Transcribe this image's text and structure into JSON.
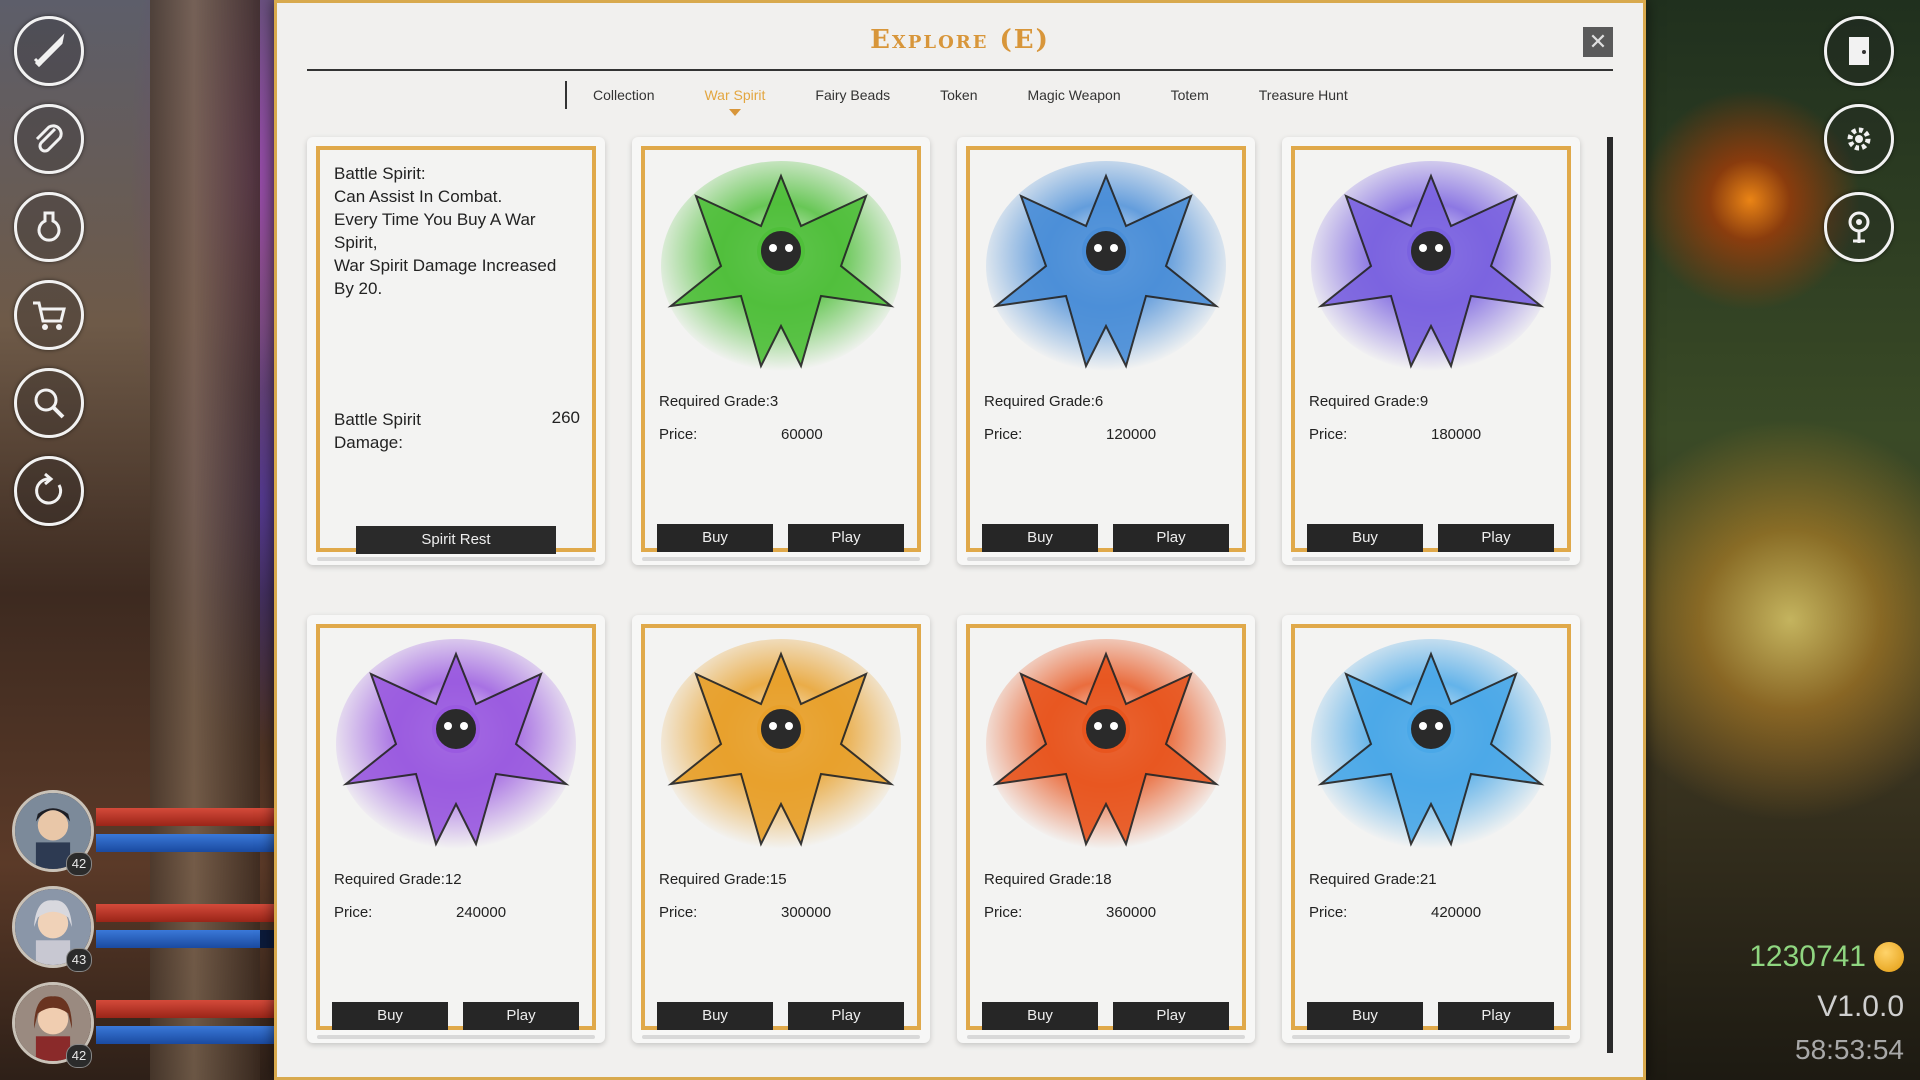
{
  "window": {
    "title": "Explore (E)"
  },
  "tabs": [
    {
      "label": "Collection",
      "active": false
    },
    {
      "label": "War Spirit",
      "active": true
    },
    {
      "label": "Fairy Beads",
      "active": false
    },
    {
      "label": "Token",
      "active": false
    },
    {
      "label": "Magic Weapon",
      "active": false
    },
    {
      "label": "Totem",
      "active": false
    },
    {
      "label": "Treasure Hunt",
      "active": false
    }
  ],
  "info_card": {
    "description": "Battle Spirit:\nCan Assist In Combat.\nEvery Time You Buy A War Spirit,\nWar Spirit Damage Increased By 20.",
    "stat_label": "Battle Spirit Damage:",
    "stat_value": "260",
    "button_label": "Spirit Rest"
  },
  "spirits": [
    {
      "required": "Required Grade:3",
      "price_label": "Price:",
      "price": "60000",
      "buy": "Buy",
      "play": "Play",
      "color": "#4fbf3a"
    },
    {
      "required": "Required Grade:6",
      "price_label": "Price:",
      "price": "120000",
      "buy": "Buy",
      "play": "Play",
      "color": "#4a8ed8"
    },
    {
      "required": "Required Grade:9",
      "price_label": "Price:",
      "price": "180000",
      "buy": "Buy",
      "play": "Play",
      "color": "#7a62e0"
    },
    {
      "required": "Required Grade:12",
      "price_label": "Price:",
      "price": "240000",
      "buy": "Buy",
      "play": "Play",
      "color": "#9a5ae0"
    },
    {
      "required": "Required Grade:15",
      "price_label": "Price:",
      "price": "300000",
      "buy": "Buy",
      "play": "Play",
      "color": "#e8a02a"
    },
    {
      "required": "Required Grade:18",
      "price_label": "Price:",
      "price": "360000",
      "buy": "Buy",
      "play": "Play",
      "color": "#e8551e"
    },
    {
      "required": "Required Grade:21",
      "price_label": "Price:",
      "price": "420000",
      "buy": "Buy",
      "play": "Play",
      "color": "#4aa8e8"
    }
  ],
  "sidebar_left": [
    "sword-icon",
    "paperclip-icon",
    "potion-icon",
    "cart-icon",
    "magnifier-icon",
    "refresh-icon"
  ],
  "sidebar_right": [
    "door-icon",
    "gear-icon",
    "map-pin-icon"
  ],
  "party": [
    {
      "level": "42",
      "hp_fraction": 1.0,
      "mp_fraction": 1.0
    },
    {
      "level": "43",
      "hp_fraction": 1.0,
      "mp_fraction": 0.92
    },
    {
      "level": "42",
      "hp_fraction": 1.0,
      "mp_fraction": 1.0
    }
  ],
  "hud": {
    "gold": "1230741",
    "version": "V1.0.0",
    "clock": "58:53:54"
  },
  "colors": {
    "accent": "#d8963a",
    "card_border": "#e0a94a",
    "button": "#262626"
  }
}
